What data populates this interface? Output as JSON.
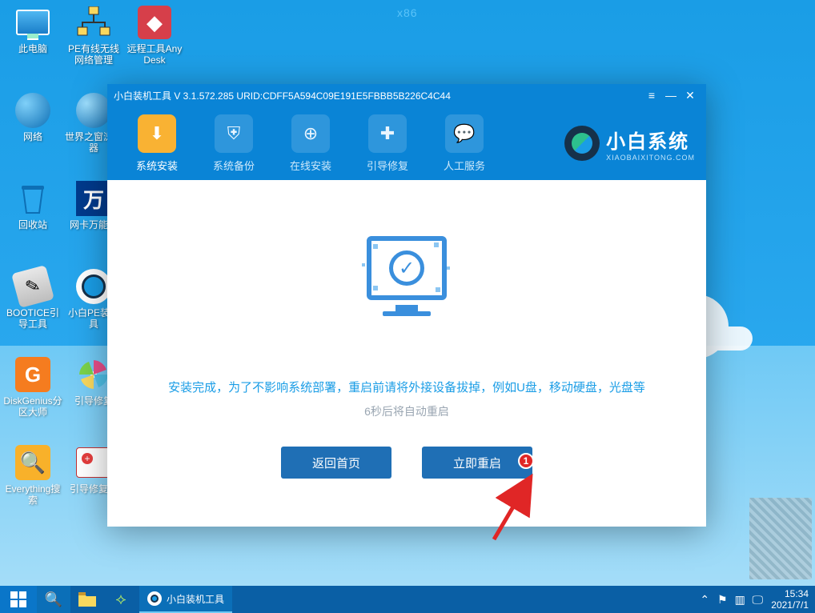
{
  "arch_badge": "x86",
  "desktop_icons": [
    {
      "id": "pc",
      "label": "此电脑"
    },
    {
      "id": "penet",
      "label": "PE有线无线网络管理"
    },
    {
      "id": "anydesk",
      "label": "远程工具AnyDesk"
    },
    {
      "id": "network",
      "label": "网络"
    },
    {
      "id": "browser",
      "label": "世界之窗浏览器"
    },
    {
      "id": "recycle",
      "label": "回收站"
    },
    {
      "id": "wandrv",
      "label": "网卡万能驱"
    },
    {
      "id": "bootice",
      "label": "BOOTICE引导工具"
    },
    {
      "id": "xbpe",
      "label": "小白PE装机具"
    },
    {
      "id": "diskgenius",
      "label": "DiskGenius分区大师"
    },
    {
      "id": "bootfix",
      "label": "引导修复"
    },
    {
      "id": "everything",
      "label": "Everything搜索"
    },
    {
      "id": "bootfix2",
      "label": "引导修复工"
    }
  ],
  "window": {
    "title": "小白装机工具 V 3.1.572.285 URID:CDFF5A594C09E191E5FBBB5B226C4C44",
    "toolbar": [
      {
        "id": "install",
        "label": "系统安装",
        "active": true,
        "icon": "download"
      },
      {
        "id": "backup",
        "label": "系统备份",
        "active": false,
        "icon": "shield"
      },
      {
        "id": "online",
        "label": "在线安装",
        "active": false,
        "icon": "circle-down"
      },
      {
        "id": "boot",
        "label": "引导修复",
        "active": false,
        "icon": "briefcase"
      },
      {
        "id": "service",
        "label": "人工服务",
        "active": false,
        "icon": "chat"
      }
    ],
    "brand": {
      "name": "小白系统",
      "sub": "XIAOBAIXITONG.COM"
    },
    "message_primary": "安装完成，为了不影响系统部署，重启前请将外接设备拔掉，例如U盘，移动硬盘，光盘等",
    "message_secondary": "6秒后将自动重启",
    "button_back": "返回首页",
    "button_restart": "立即重启",
    "annotation_badge": "1"
  },
  "taskbar": {
    "active_task": "小白装机工具",
    "time": "15:34",
    "date": "2021/7/1"
  }
}
